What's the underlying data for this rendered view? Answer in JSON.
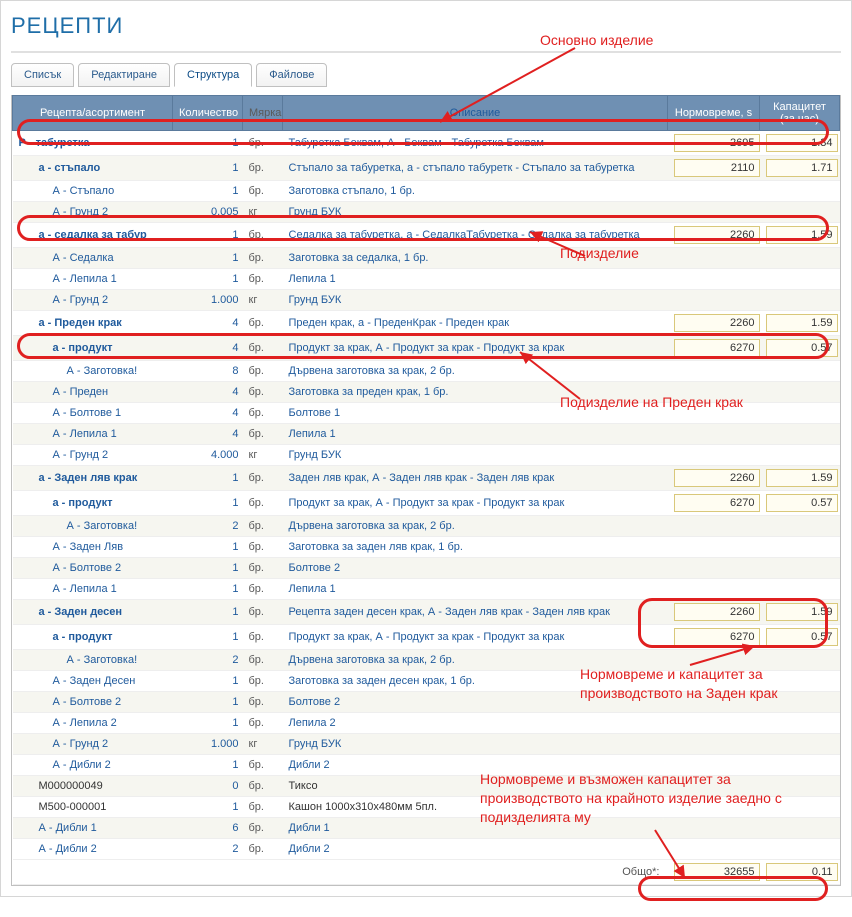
{
  "page_title": "РЕЦЕПТИ",
  "tabs": {
    "list": "Списък",
    "edit": "Редактиране",
    "structure": "Структура",
    "files": "Файлове"
  },
  "headers": {
    "name": "Рецепта/асортимент",
    "qty": "Количество",
    "unit": "Мярка",
    "desc": "Описание",
    "norm": "Нормовреме, s",
    "cap": "Капацитет (за час)"
  },
  "rows": [
    {
      "ind": 0,
      "bold": 1,
      "name": "Р - табуретка",
      "qty": "1",
      "unit": "бр.",
      "desc": "Табуретка Беквам, А - Беквам - Табуретка Беквам",
      "norm": "2695",
      "cap": "1.34",
      "link": 1
    },
    {
      "ind": 1,
      "bold": 1,
      "name": "а - стъпало",
      "qty": "1",
      "unit": "бр.",
      "desc": "Стъпало за табуретка, а - стъпало табуретк - Стъпало за табуретка",
      "norm": "2110",
      "cap": "1.71",
      "link": 1,
      "alt": 1
    },
    {
      "ind": 2,
      "name": "А - Стъпало",
      "qty": "1",
      "unit": "бр.",
      "desc": "Заготовка стъпало, 1 бр.",
      "link": 1
    },
    {
      "ind": 2,
      "name": "А - Грунд 2",
      "qty": "0.005",
      "unit": "кг",
      "desc": "Грунд БУК",
      "link": 1,
      "alt": 1
    },
    {
      "ind": 1,
      "bold": 1,
      "name": "а - седалка за табур",
      "qty": "1",
      "unit": "бр.",
      "desc": "Седалка за табуретка, а - СедалкаТабуретка - Седалка за табуретка",
      "norm": "2260",
      "cap": "1.59",
      "link": 1
    },
    {
      "ind": 2,
      "name": "А - Седалка",
      "qty": "1",
      "unit": "бр.",
      "desc": "Заготовка за седалка, 1 бр.",
      "link": 1,
      "alt": 1
    },
    {
      "ind": 2,
      "name": "А - Лепила 1",
      "qty": "1",
      "unit": "бр.",
      "desc": "Лепила 1",
      "link": 1
    },
    {
      "ind": 2,
      "name": "А - Грунд 2",
      "qty": "1.000",
      "unit": "кг",
      "desc": "Грунд БУК",
      "link": 1,
      "alt": 1
    },
    {
      "ind": 1,
      "bold": 1,
      "name": "а - Преден крак",
      "qty": "4",
      "unit": "бр.",
      "desc": "Преден крак, а - ПреденКрак - Преден крак",
      "norm": "2260",
      "cap": "1.59",
      "link": 1
    },
    {
      "ind": 2,
      "bold": 1,
      "name": "а - продукт",
      "qty": "4",
      "unit": "бр.",
      "desc": "Продукт за крак, А - Продукт за крак - Продукт за крак",
      "norm": "6270",
      "cap": "0.57",
      "link": 1,
      "alt": 1
    },
    {
      "ind": 3,
      "name": "А - Заготовка!",
      "qty": "8",
      "unit": "бр.",
      "desc": "Дървена заготовка за крак, 2 бр.",
      "link": 1
    },
    {
      "ind": 2,
      "name": "А - Преден",
      "qty": "4",
      "unit": "бр.",
      "desc": "Заготовка за преден крак, 1 бр.",
      "link": 1,
      "alt": 1
    },
    {
      "ind": 2,
      "name": "А - Болтове 1",
      "qty": "4",
      "unit": "бр.",
      "desc": "Болтове 1",
      "link": 1
    },
    {
      "ind": 2,
      "name": "А - Лепила 1",
      "qty": "4",
      "unit": "бр.",
      "desc": "Лепила 1",
      "link": 1,
      "alt": 1
    },
    {
      "ind": 2,
      "name": "А - Грунд 2",
      "qty": "4.000",
      "unit": "кг",
      "desc": "Грунд БУК",
      "link": 1
    },
    {
      "ind": 1,
      "bold": 1,
      "name": "а - Заден ляв крак",
      "qty": "1",
      "unit": "бр.",
      "desc": "Заден ляв крак, А - Заден ляв крак - Заден ляв крак",
      "norm": "2260",
      "cap": "1.59",
      "link": 1,
      "alt": 1
    },
    {
      "ind": 2,
      "bold": 1,
      "name": "а - продукт",
      "qty": "1",
      "unit": "бр.",
      "desc": "Продукт за крак, А - Продукт за крак - Продукт за крак",
      "norm": "6270",
      "cap": "0.57",
      "link": 1
    },
    {
      "ind": 3,
      "name": "А - Заготовка!",
      "qty": "2",
      "unit": "бр.",
      "desc": "Дървена заготовка за крак, 2 бр.",
      "link": 1,
      "alt": 1
    },
    {
      "ind": 2,
      "name": "А - Заден Ляв",
      "qty": "1",
      "unit": "бр.",
      "desc": "Заготовка за заден ляв крак, 1 бр.",
      "link": 1
    },
    {
      "ind": 2,
      "name": "А - Болтове 2",
      "qty": "1",
      "unit": "бр.",
      "desc": "Болтове 2",
      "link": 1,
      "alt": 1
    },
    {
      "ind": 2,
      "name": "А - Лепила 1",
      "qty": "1",
      "unit": "бр.",
      "desc": "Лепила 1",
      "link": 1
    },
    {
      "ind": 1,
      "bold": 1,
      "name": "а - Заден десен",
      "qty": "1",
      "unit": "бр.",
      "desc": "Рецепта заден десен крак, А - Заден ляв крак - Заден ляв крак",
      "norm": "2260",
      "cap": "1.59",
      "link": 1,
      "alt": 1
    },
    {
      "ind": 2,
      "bold": 1,
      "name": "а - продукт",
      "qty": "1",
      "unit": "бр.",
      "desc": "Продукт за крак, А - Продукт за крак - Продукт за крак",
      "norm": "6270",
      "cap": "0.57",
      "link": 1
    },
    {
      "ind": 3,
      "name": "А - Заготовка!",
      "qty": "2",
      "unit": "бр.",
      "desc": "Дървена заготовка за крак, 2 бр.",
      "link": 1,
      "alt": 1
    },
    {
      "ind": 2,
      "name": "А - Заден Десен",
      "qty": "1",
      "unit": "бр.",
      "desc": "Заготовка за заден десен крак, 1 бр.",
      "link": 1
    },
    {
      "ind": 2,
      "name": "А - Болтове 2",
      "qty": "1",
      "unit": "бр.",
      "desc": "Болтове 2",
      "link": 1,
      "alt": 1
    },
    {
      "ind": 2,
      "name": "А - Лепила 2",
      "qty": "1",
      "unit": "бр.",
      "desc": "Лепила 2",
      "link": 1
    },
    {
      "ind": 2,
      "name": "А - Грунд 2",
      "qty": "1.000",
      "unit": "кг",
      "desc": "Грунд БУК",
      "link": 1,
      "alt": 1
    },
    {
      "ind": 2,
      "name": "А - Дибли 2",
      "qty": "1",
      "unit": "бр.",
      "desc": "Дибли 2",
      "link": 1
    },
    {
      "ind": 1,
      "name": "M000000049",
      "qty": "0",
      "unit": "бр.",
      "desc": "Тиксо",
      "black": 1,
      "alt": 1
    },
    {
      "ind": 1,
      "name": "M500-000001",
      "qty": "1",
      "unit": "бр.",
      "desc": "Кашон 1000х310х480мм 5пл.",
      "black": 1
    },
    {
      "ind": 1,
      "name": "А - Дибли 1",
      "qty": "6",
      "unit": "бр.",
      "desc": "Дибли 1",
      "link": 1,
      "alt": 1
    },
    {
      "ind": 1,
      "name": "А - Дибли 2",
      "qty": "2",
      "unit": "бр.",
      "desc": "Дибли 2",
      "link": 1
    }
  ],
  "total": {
    "label": "Общо*:",
    "norm": "32655",
    "cap": "0.11"
  },
  "annotations": {
    "main_product": "Основно изделие",
    "sub_product": "Подизделие",
    "sub_of_front": "Подизделие на Преден крак",
    "norm_cap_back": "Нормовреме и капацитет за производството на Заден крак",
    "norm_cap_final": "Нормовреме и възможен капацитет за производството на крайното изделие заедно с подизделията му"
  }
}
